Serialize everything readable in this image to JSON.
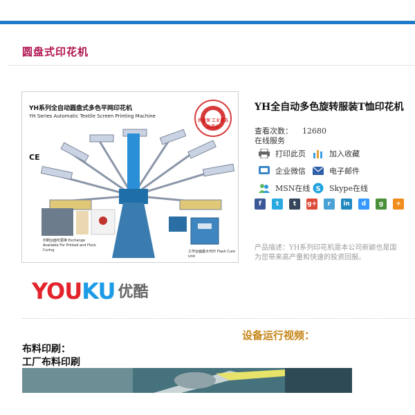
{
  "category": {
    "title": "圆盘式印花机"
  },
  "product_image": {
    "title": "YH系列全自动圆盘式多色平网印花机",
    "subtitle": "YH Series Automatic Textile Screen Printing Machine",
    "ce_mark": "CE",
    "caption_left": "印刷台面可更换 Exchange Available For Printed and Flock Curing",
    "caption_right": "工作台面最大可印 Flash Cure Unit",
    "slogan": "质量保 工业首选 品质好"
  },
  "product": {
    "name": "YH全自动多色旋转服装T恤印花机",
    "views_label": "查看次数：",
    "views_count": "12680",
    "online_service_label": "在线服务"
  },
  "services": [
    {
      "label": "打印此页",
      "icon": "printer-icon"
    },
    {
      "label": "加入收藏",
      "icon": "bookmark-chart-icon"
    },
    {
      "label": "企业微信",
      "icon": "wechat-icon"
    },
    {
      "label": "电子邮件",
      "icon": "email-icon"
    },
    {
      "label": "MSN在线",
      "icon": "msn-icon"
    },
    {
      "label": "Skype在线",
      "icon": "skype-icon"
    }
  ],
  "share_icons": [
    {
      "name": "facebook",
      "glyph": "f",
      "color": "#3b5998"
    },
    {
      "name": "twitter",
      "glyph": "t",
      "color": "#2aa9e0"
    },
    {
      "name": "tumblr",
      "glyph": "t",
      "color": "#35465c"
    },
    {
      "name": "google-plus",
      "glyph": "g+",
      "color": "#dd4b39"
    },
    {
      "name": "reddit",
      "glyph": "r",
      "color": "#4aa1d4"
    },
    {
      "name": "linkedin",
      "glyph": "in",
      "color": "#1f88be"
    },
    {
      "name": "delicious",
      "glyph": "d",
      "color": "#3399ff"
    },
    {
      "name": "google-bookmark",
      "glyph": "g",
      "color": "#4a8f3a"
    },
    {
      "name": "more",
      "glyph": "+",
      "color": "#f08c1c"
    }
  ],
  "description": {
    "label": "产品描述：",
    "line1": "YH系列印花机是本公司新颖也是国",
    "line2": "为您带来高产量和快速的投资回报。"
  },
  "youku": {
    "latin_you": "YOU",
    "latin_ku": "KU",
    "chinese": "优酷"
  },
  "video_section": {
    "heading": "设备运行视频：",
    "label1": "布料印刷：",
    "label2": "工厂布料印刷"
  },
  "colors": {
    "top_bar": "#1f7ac9",
    "category_title": "#b0124f",
    "video_heading": "#c58415"
  }
}
